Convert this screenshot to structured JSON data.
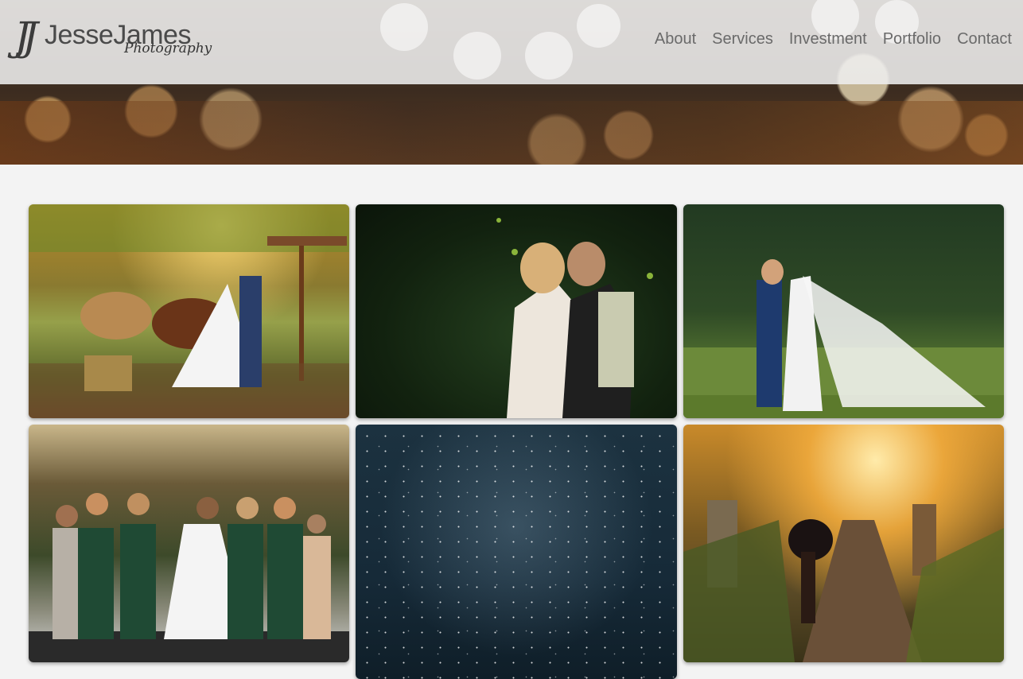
{
  "site": {
    "logo": {
      "mark": "JJ",
      "name": "JesseJames",
      "tagline": "Photography"
    }
  },
  "nav": {
    "items": [
      {
        "label": "About"
      },
      {
        "label": "Services"
      },
      {
        "label": "Investment"
      },
      {
        "label": "Portfolio"
      },
      {
        "label": "Contact"
      }
    ]
  },
  "gallery": {
    "photos": [
      {
        "subject": "couple kissing beside two horses at a fence"
      },
      {
        "subject": "couple embracing in dark green orchard"
      },
      {
        "subject": "bride and groom kissing with long veil on lawn"
      },
      {
        "subject": "bride with bridesmaids in green dresses and shawls"
      },
      {
        "subject": "starry night sky"
      },
      {
        "subject": "couple on sunlit country road at sunset"
      }
    ]
  }
}
